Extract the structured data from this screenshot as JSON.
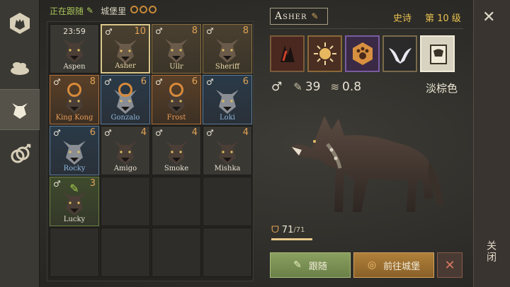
{
  "header": {
    "following_label": "正在跟随",
    "castle_label": "城堡里"
  },
  "wolves": [
    {
      "timer": "23:59",
      "name": "Aspen",
      "level": "",
      "style": "filled"
    },
    {
      "name": "Asher",
      "level": "10",
      "style": "gold selected"
    },
    {
      "name": "Ullr",
      "level": "8",
      "style": "gold"
    },
    {
      "name": "Sheriff",
      "level": "8",
      "style": "gold"
    },
    {
      "name": "King Kong",
      "level": "8",
      "style": "orange",
      "badge": "ring"
    },
    {
      "name": "Gonzalo",
      "level": "6",
      "style": "blue",
      "badge": "ring"
    },
    {
      "name": "Frost",
      "level": "6",
      "style": "orange",
      "badge": "ring"
    },
    {
      "name": "Loki",
      "level": "6",
      "style": "blue"
    },
    {
      "name": "Rocky",
      "level": "6",
      "style": "blue"
    },
    {
      "name": "Amigo",
      "level": "4",
      "style": "filled"
    },
    {
      "name": "Smoke",
      "level": "4",
      "style": "filled"
    },
    {
      "name": "Mishka",
      "level": "4",
      "style": "filled"
    },
    {
      "name": "Lucky",
      "level": "3",
      "style": "green",
      "badge": "follow"
    }
  ],
  "selected": {
    "name": "Asher",
    "rarity": "史诗",
    "level_text": "第 10 级",
    "attack": "39",
    "speed": "0.8",
    "coat_color": "淡棕色",
    "hp": "71",
    "hp_max": "/71",
    "hp_fraction": 1.0
  },
  "buttons": {
    "follow": "跟随",
    "goto_castle": "前往城堡",
    "dismiss": "✕"
  },
  "close": {
    "x": "✕",
    "label": "关闭"
  },
  "icons": {
    "male": "♂",
    "edit": "pencil-icon"
  }
}
